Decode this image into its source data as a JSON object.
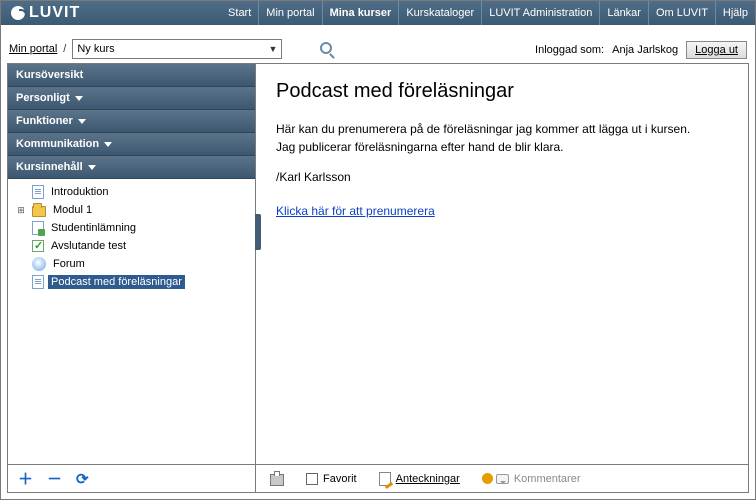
{
  "logo": "LUVIT",
  "topnav": {
    "items": [
      {
        "label": "Start",
        "active": false
      },
      {
        "label": "Min portal",
        "active": false
      },
      {
        "label": "Mina kurser",
        "active": true
      },
      {
        "label": "Kurskataloger",
        "active": false
      },
      {
        "label": "LUVIT Administration",
        "active": false
      },
      {
        "label": "Länkar",
        "active": false
      },
      {
        "label": "Om LUVIT",
        "active": false
      },
      {
        "label": "Hjälp",
        "active": false
      }
    ]
  },
  "toolbar": {
    "breadcrumb": "Min portal",
    "separator": "/",
    "course_select_value": "Ny kurs",
    "logged_in_prefix": "Inloggad som:",
    "logged_in_user": "Anja Jarlskog",
    "logout_label": "Logga ut"
  },
  "sidebar": {
    "headers": [
      {
        "label": "Kursöversikt",
        "has_caret": false
      },
      {
        "label": "Personligt",
        "has_caret": true
      },
      {
        "label": "Funktioner",
        "has_caret": true
      },
      {
        "label": "Kommunikation",
        "has_caret": true
      },
      {
        "label": "Kursinnehåll",
        "has_caret": true
      }
    ],
    "tree": [
      {
        "label": "Introduktion",
        "icon": "page",
        "expander": "",
        "selected": false
      },
      {
        "label": "Modul 1",
        "icon": "folder",
        "expander": "⊞",
        "selected": false
      },
      {
        "label": "Studentinlämning",
        "icon": "upload",
        "expander": "",
        "selected": false
      },
      {
        "label": "Avslutande test",
        "icon": "check",
        "expander": "",
        "selected": false
      },
      {
        "label": "Forum",
        "icon": "forum",
        "expander": "",
        "selected": false
      },
      {
        "label": "Podcast med föreläsningar",
        "icon": "page",
        "expander": "",
        "selected": true
      }
    ]
  },
  "content": {
    "title": "Podcast med föreläsningar",
    "line1": "Här kan du prenumerera på de föreläsningar jag kommer att lägga ut i kursen.",
    "line2": "Jag publicerar föreläsningarna efter hand de blir klara.",
    "signature": "/Karl Karlsson",
    "subscribe_link": "Klicka här för att prenumerera "
  },
  "content_bottom": {
    "favorite": "Favorit",
    "notes": "Anteckningar",
    "comments": "Kommentarer"
  }
}
